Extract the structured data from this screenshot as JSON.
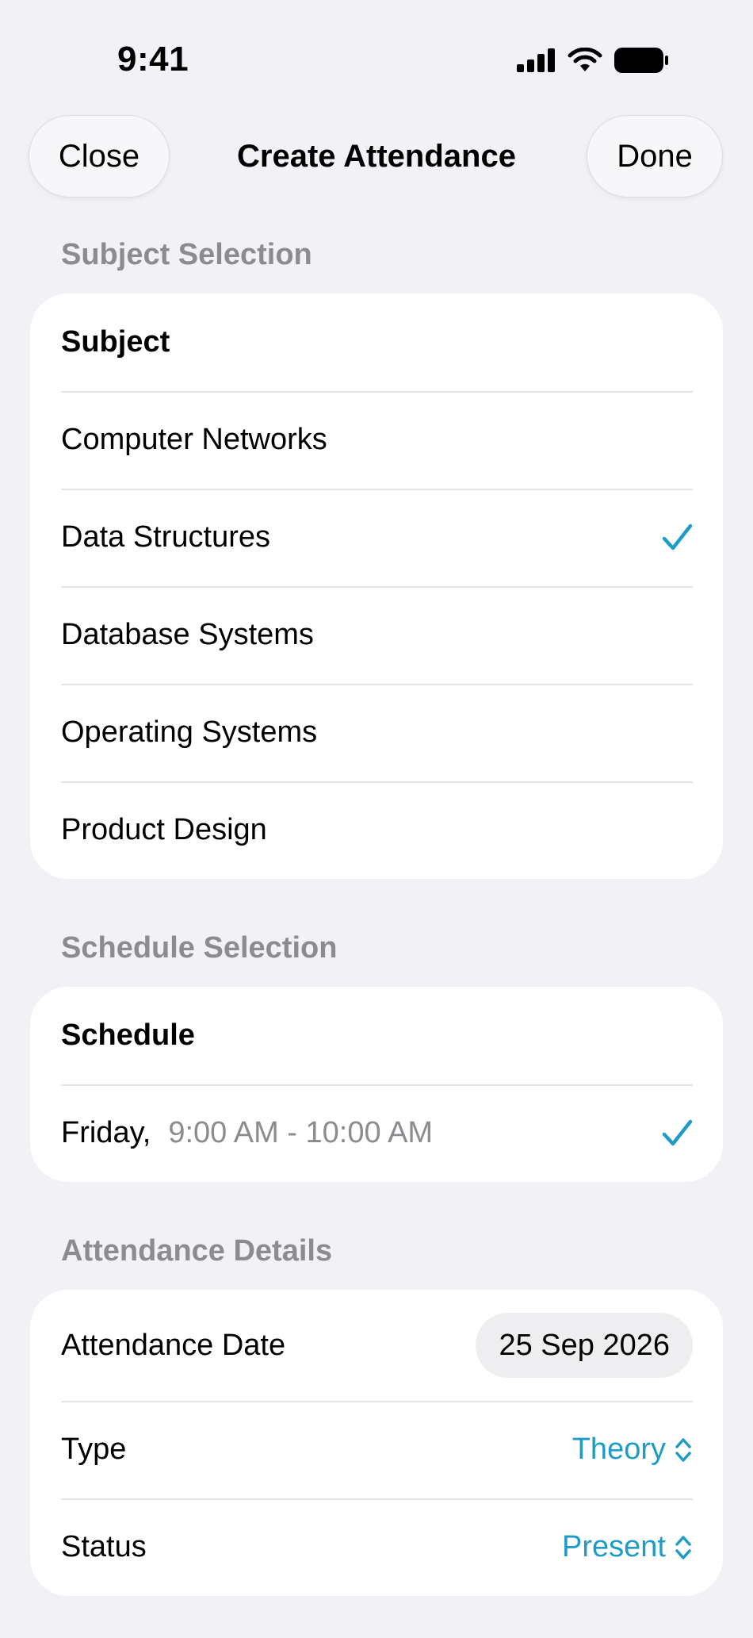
{
  "status_bar": {
    "time": "9:41"
  },
  "nav": {
    "close_label": "Close",
    "title": "Create Attendance",
    "done_label": "Done"
  },
  "subject_section": {
    "header": "Subject Selection",
    "title": "Subject",
    "items": [
      {
        "label": "Computer Networks",
        "selected": false
      },
      {
        "label": "Data Structures",
        "selected": true
      },
      {
        "label": "Database Systems",
        "selected": false
      },
      {
        "label": "Operating Systems",
        "selected": false
      },
      {
        "label": "Product Design",
        "selected": false
      }
    ]
  },
  "schedule_section": {
    "header": "Schedule Selection",
    "title": "Schedule",
    "item": {
      "day": "Friday,",
      "time": "9:00 AM - 10:00 AM",
      "selected": true
    }
  },
  "attendance_section": {
    "header": "Attendance Details",
    "date_label": "Attendance Date",
    "date_value": "25 Sep 2026",
    "type_label": "Type",
    "type_value": "Theory",
    "status_label": "Status",
    "status_value": "Present"
  },
  "colors": {
    "accent": "#1e9bc7",
    "background": "#f2f1f6",
    "secondary_text": "#8b8b90"
  }
}
